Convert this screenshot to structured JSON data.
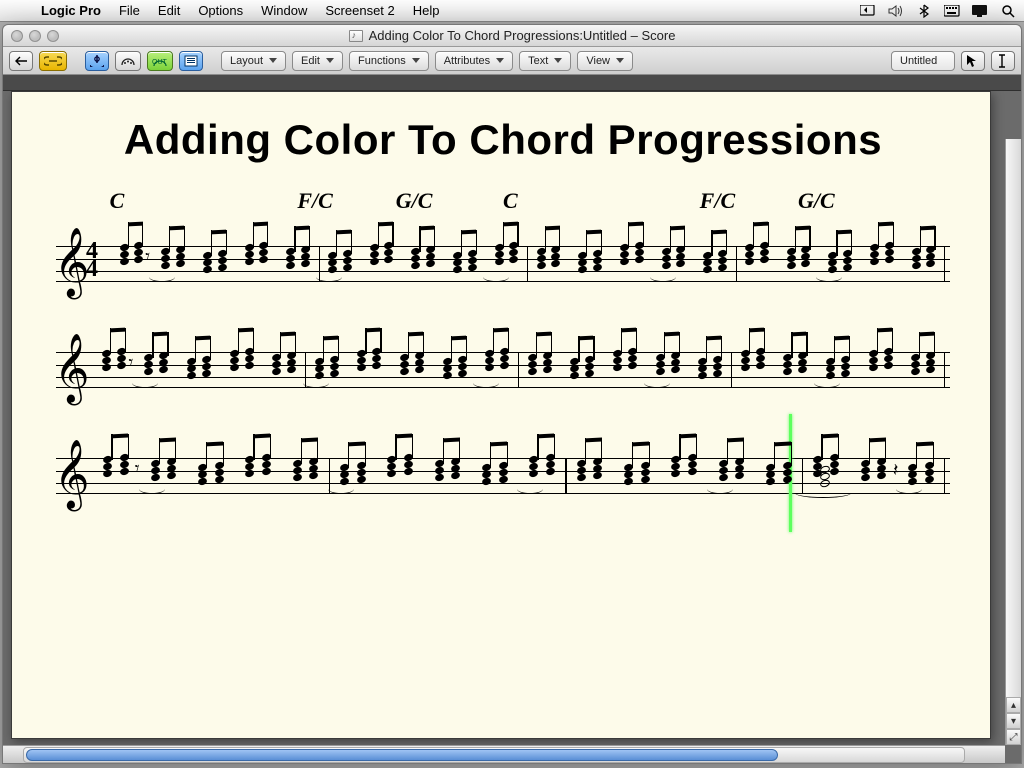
{
  "menubar": {
    "apple": "",
    "app": "Logic Pro",
    "items": [
      "File",
      "Edit",
      "Options",
      "Window",
      "Screenset 2",
      "Help"
    ]
  },
  "status_icons": [
    "screen-share",
    "volume",
    "bluetooth",
    "input-menu",
    "battery",
    "spotlight"
  ],
  "window": {
    "title": "Adding Color To Chord Progressions:Untitled – Score"
  },
  "toolbar": {
    "icon_buttons": [
      {
        "name": "back-arrow",
        "style": "plain"
      },
      {
        "name": "link-chain",
        "style": "active"
      },
      {
        "name": "catch-in",
        "style": "blue"
      },
      {
        "name": "catch-out",
        "style": "plain"
      },
      {
        "name": "midi-out",
        "style": "green"
      },
      {
        "name": "page-view",
        "style": "blue"
      }
    ],
    "menus": [
      "Layout",
      "Edit",
      "Functions",
      "Attributes",
      "Text",
      "View"
    ],
    "right_label": "Untitled",
    "tool_cursor": "arrow",
    "tool_text": "text"
  },
  "score": {
    "title": "Adding Color To Chord Progressions",
    "time_sig": {
      "top": "4",
      "bottom": "4"
    },
    "chord_labels_line1": [
      {
        "text": "C",
        "pos": 6
      },
      {
        "text": "F/C",
        "pos": 27
      },
      {
        "text": "G/C",
        "pos": 38
      },
      {
        "text": "C",
        "pos": 50
      },
      {
        "text": "F/C",
        "pos": 72
      },
      {
        "text": "G/C",
        "pos": 83
      }
    ],
    "systems": 3,
    "playhead_system": 2,
    "playhead_percent": 82
  }
}
